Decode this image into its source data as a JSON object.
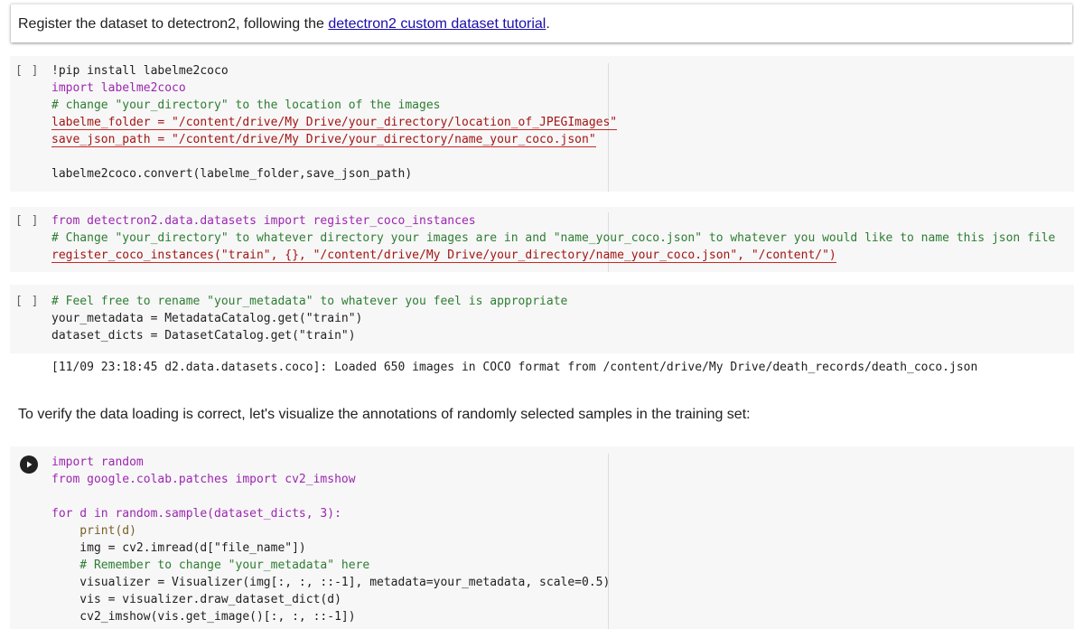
{
  "intro": {
    "prefix": "Register the dataset to detectron2, following the ",
    "link": "detectron2 custom dataset tutorial",
    "suffix": "."
  },
  "cell_bracket": "[ ]",
  "cell1_lines": [
    "!pip install labelme2coco",
    "import labelme2coco",
    "# change \"your_directory\" to the location of the images",
    "labelme_folder = \"/content/drive/My Drive/your_directory/location_of_JPEGImages\"",
    "save_json_path = \"/content/drive/My Drive/your_directory/name_your_coco.json\"",
    "",
    "labelme2coco.convert(labelme_folder,save_json_path)"
  ],
  "cell2_lines": [
    "from detectron2.data.datasets import register_coco_instances",
    "# Change \"your_directory\" to whatever directory your images are in and \"name_your_coco.json\" to whatever you would like to name this json file",
    "register_coco_instances(\"train\", {}, \"/content/drive/My Drive/your_directory/name_your_coco.json\", \"/content/\")"
  ],
  "cell3_lines": [
    "# Feel free to rename \"your_metadata\" to whatever you feel is appropriate",
    "your_metadata = MetadataCatalog.get(\"train\")",
    "dataset_dicts = DatasetCatalog.get(\"train\")"
  ],
  "cell3_output": "[11/09 23:18:45 d2.data.datasets.coco]: Loaded 650 images in COCO format from /content/drive/My Drive/death_records/death_coco.json",
  "verify_text": "To verify the data loading is correct, let's visualize the annotations of randomly selected samples in the training set:",
  "cell4_lines": [
    "import random",
    "from google.colab.patches import cv2_imshow",
    "",
    "for d in random.sample(dataset_dicts, 3):",
    "    print(d)",
    "    img = cv2.imread(d[\"file_name\"])",
    "    # Remember to change \"your_metadata\" here",
    "    visualizer = Visualizer(img[:, :, ::-1], metadata=your_metadata, scale=0.5)",
    "    vis = visualizer.draw_dataset_dict(d)",
    "    cv2_imshow(vis.get_image()[:, :, ::-1])"
  ],
  "run_icon": "play-icon",
  "colors": {
    "keyword": "#9c27b0",
    "comment": "#2e7d32",
    "string": "#a31515",
    "number": "#0e8a8a",
    "link": "#1a0dab",
    "cell_bg": "#f7f7f7"
  }
}
